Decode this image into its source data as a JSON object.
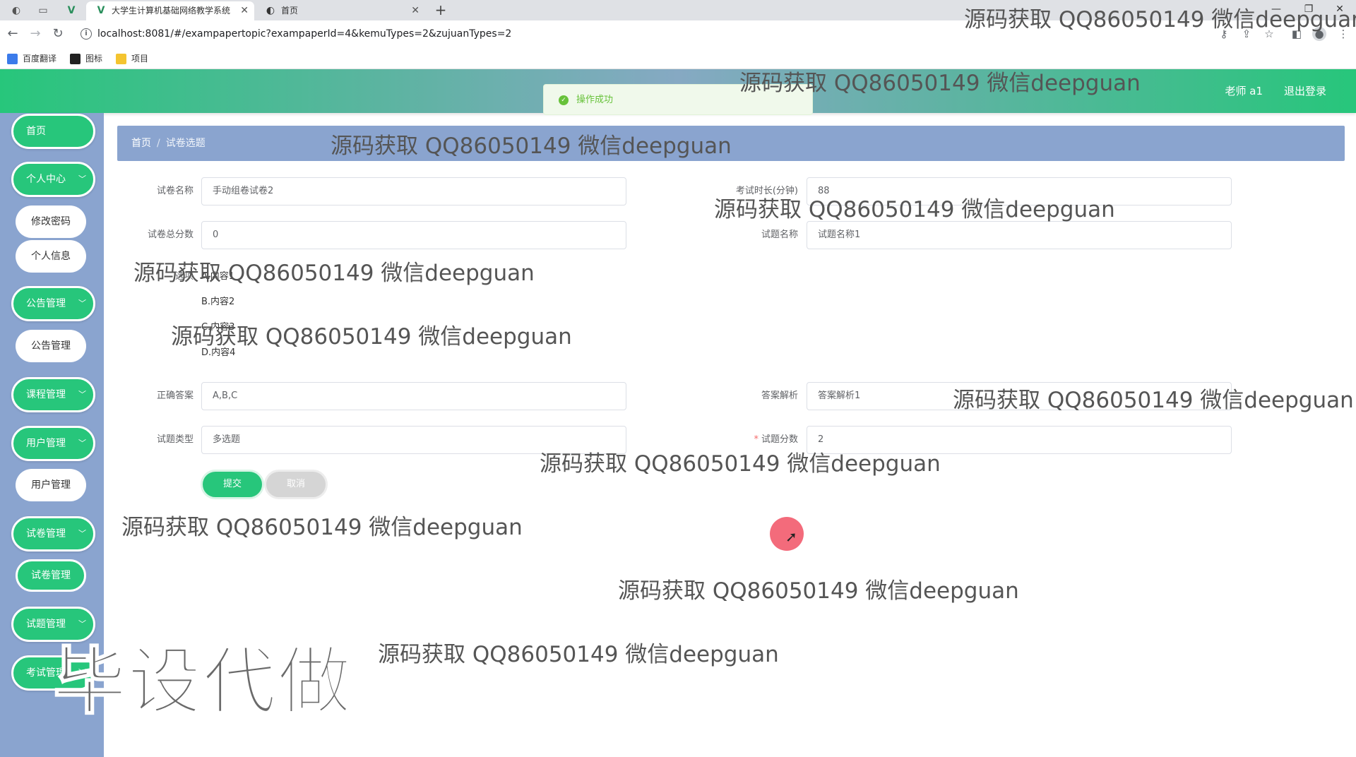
{
  "browser": {
    "tabs": [
      {
        "title": "大学生计算机基础网络教学系统",
        "active": true
      },
      {
        "title": "首页",
        "active": false
      }
    ],
    "new_tab_symbol": "+",
    "url": "localhost:8081/#/exampapertopic?exampaperId=4&kemuTypes=2&zujuanTypes=2",
    "bookmarks": [
      "百度翻译",
      "图标",
      "项目"
    ]
  },
  "header": {
    "user": "老师 a1",
    "logout": "退出登录"
  },
  "toast": {
    "message": "操作成功"
  },
  "sidebar": {
    "home": "首页",
    "personal_center": "个人中心",
    "change_password": "修改密码",
    "personal_info": "个人信息",
    "notice_mgmt": "公告管理",
    "notice_mgmt_sub": "公告管理",
    "course_mgmt": "课程管理",
    "user_mgmt": "用户管理",
    "user_mgmt_sub": "用户管理",
    "paper_mgmt": "试卷管理",
    "paper_mgmt_sub": "试卷管理",
    "question_mgmt": "试题管理",
    "exam_mgmt": "考试管理"
  },
  "breadcrumb": {
    "home": "首页",
    "separator": "/",
    "current": "试卷选题"
  },
  "form": {
    "paper_name_label": "试卷名称",
    "paper_name_value": "手动组卷试卷2",
    "exam_duration_label": "考试时长(分钟)",
    "exam_duration_value": "88",
    "paper_total_label": "试卷总分数",
    "paper_total_value": "0",
    "question_name_label": "试题名称",
    "question_name_value": "试题名称1",
    "options_label": "选项",
    "options": [
      "A.内容1",
      "B.内容2",
      "C.内容3",
      "D.内容4"
    ],
    "correct_answer_label": "正确答案",
    "correct_answer_value": "A,B,C",
    "analysis_label": "答案解析",
    "analysis_value": "答案解析1",
    "question_type_label": "试题类型",
    "question_type_value": "多选题",
    "question_score_label": "试题分数",
    "question_score_value": "2",
    "submit": "提交",
    "cancel": "取消"
  },
  "watermarks": {
    "text": "源码获取 QQ86050149 微信deepguan",
    "big": "毕设代做"
  },
  "colors": {
    "accent_green": "#27c67b",
    "sidebar_blue": "#8aa4cf",
    "toast_green": "#67c23a"
  }
}
